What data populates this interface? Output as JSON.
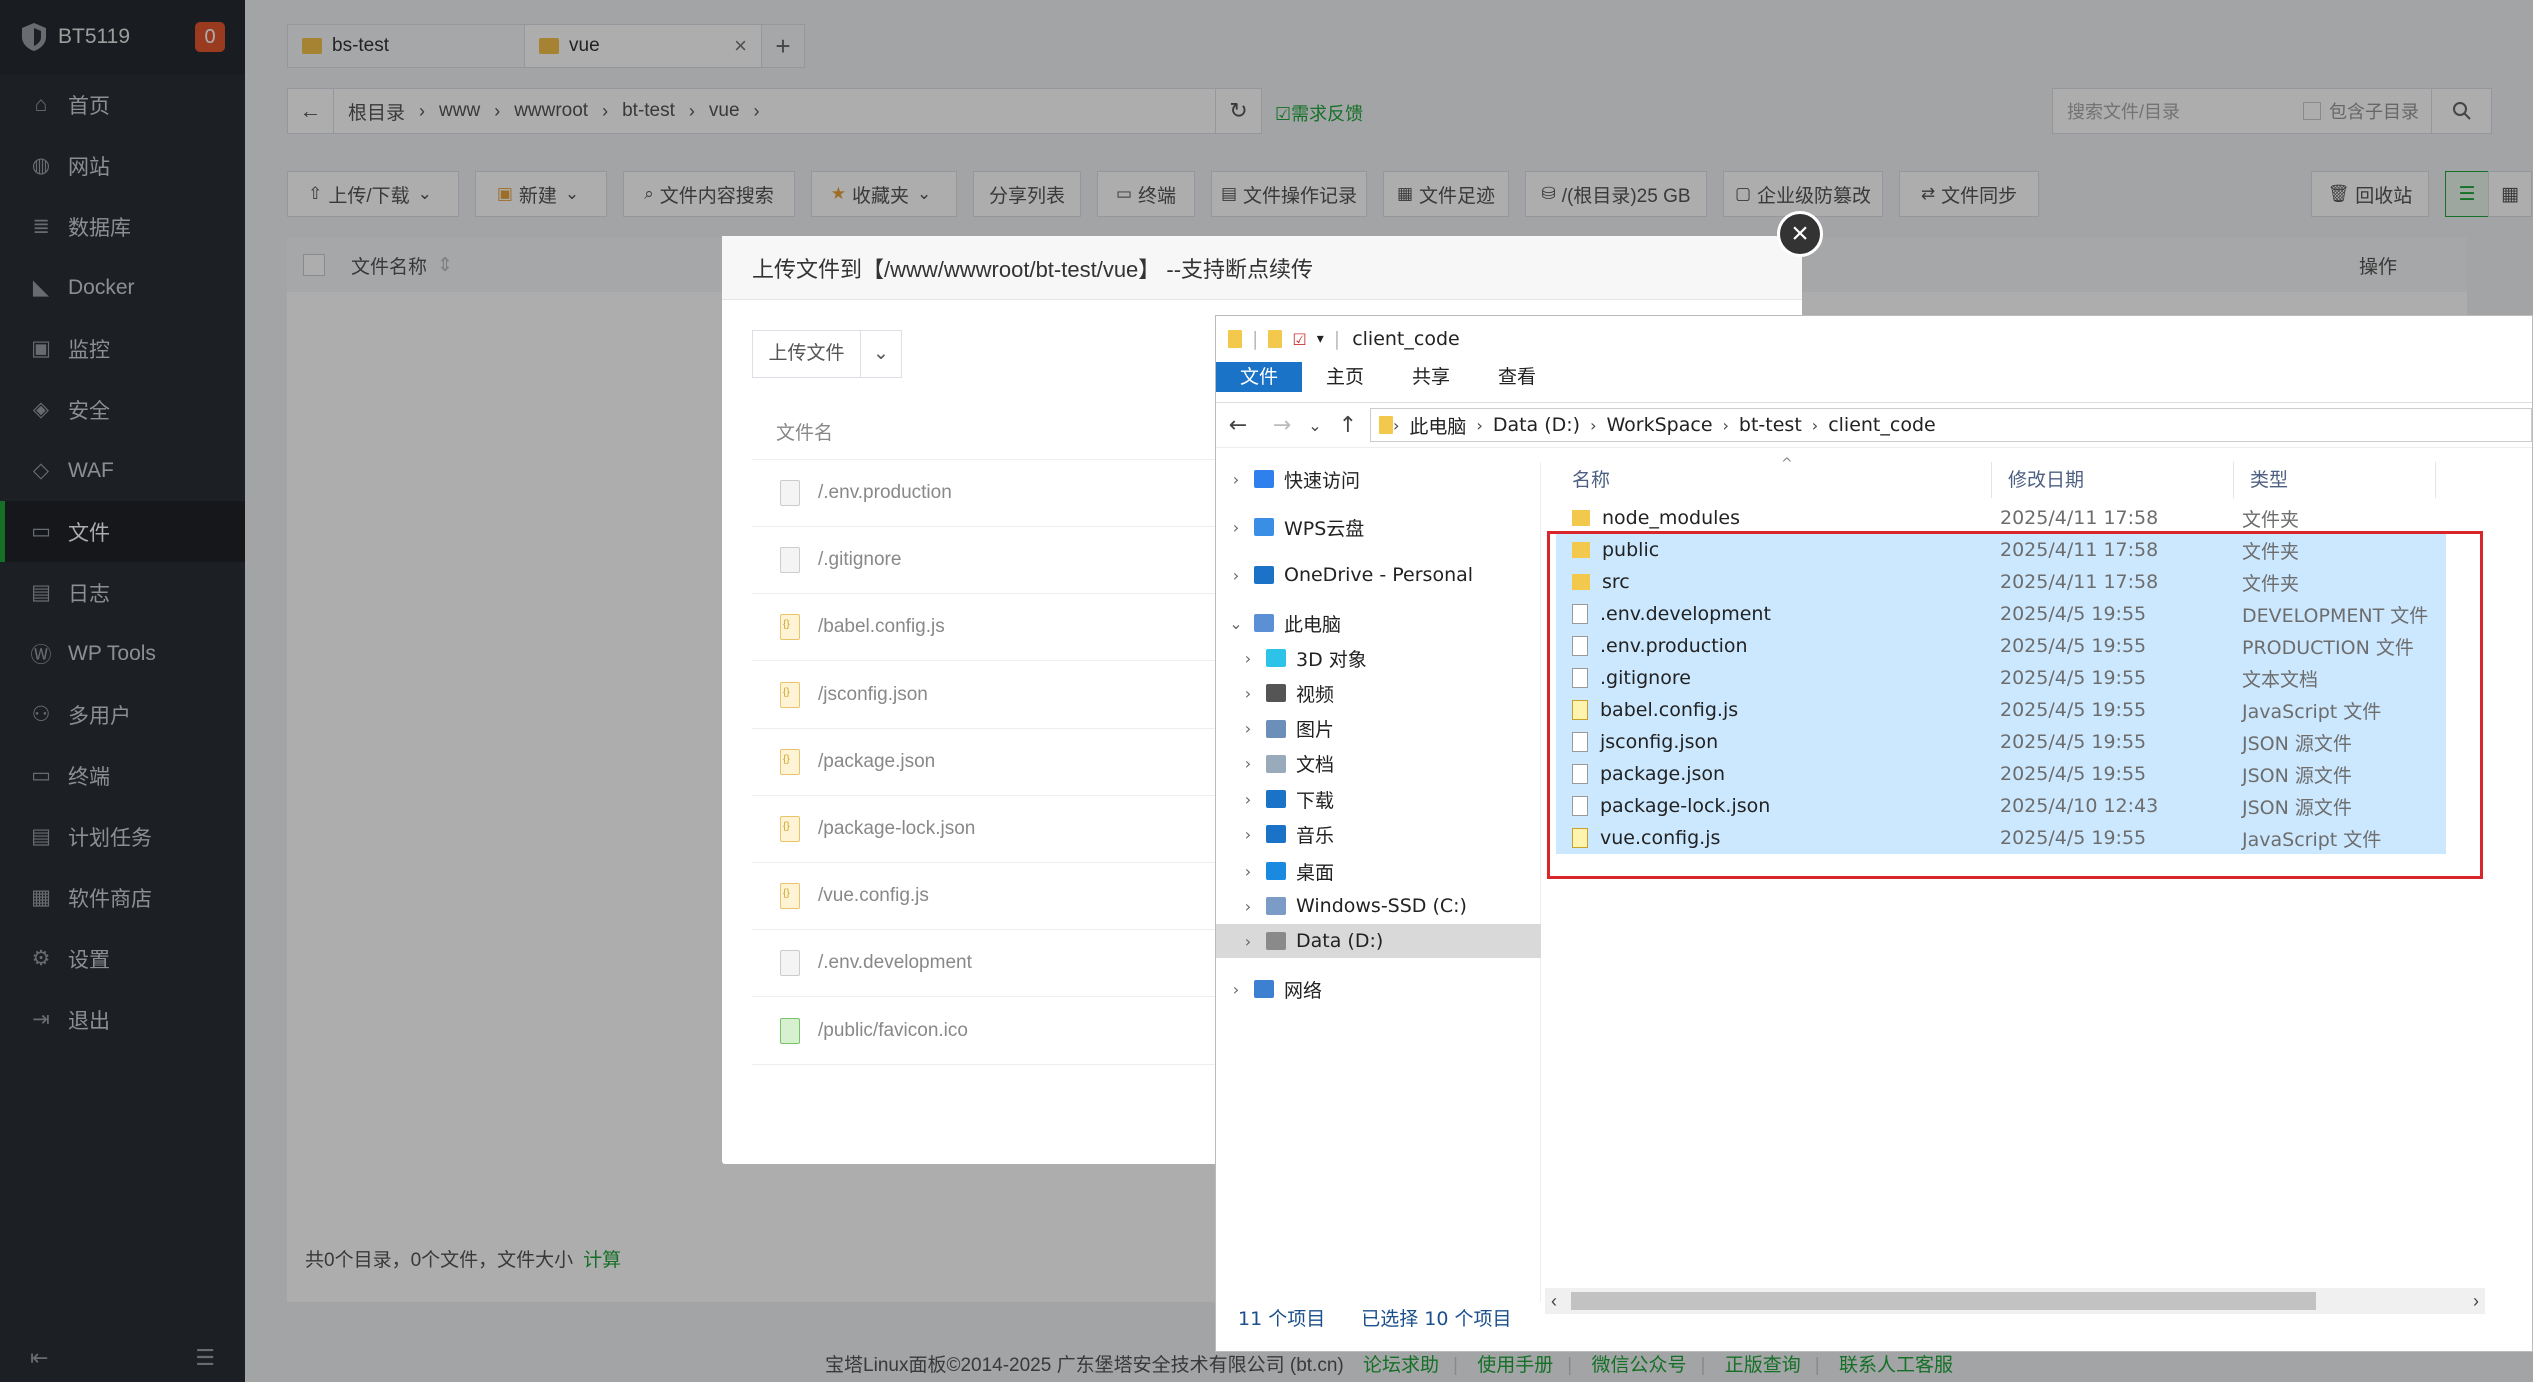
{
  "sidebar": {
    "brand": "BT5119",
    "badge": "0",
    "items": [
      {
        "label": "首页",
        "icon": "home-icon"
      },
      {
        "label": "网站",
        "icon": "globe-icon"
      },
      {
        "label": "数据库",
        "icon": "database-icon"
      },
      {
        "label": "Docker",
        "icon": "docker-icon"
      },
      {
        "label": "监控",
        "icon": "monitor-icon"
      },
      {
        "label": "安全",
        "icon": "shield-icon"
      },
      {
        "label": "WAF",
        "icon": "waf-icon"
      },
      {
        "label": "文件",
        "icon": "folder-icon"
      },
      {
        "label": "日志",
        "icon": "log-icon"
      },
      {
        "label": "WP Tools",
        "icon": "wordpress-icon"
      },
      {
        "label": "多用户",
        "icon": "users-icon"
      },
      {
        "label": "终端",
        "icon": "terminal-icon"
      },
      {
        "label": "计划任务",
        "icon": "schedule-icon"
      },
      {
        "label": "软件商店",
        "icon": "store-icon"
      },
      {
        "label": "设置",
        "icon": "gear-icon"
      },
      {
        "label": "退出",
        "icon": "logout-icon"
      }
    ],
    "active": "文件"
  },
  "tabs": [
    {
      "label": "bs-test"
    },
    {
      "label": "vue",
      "close": "×"
    }
  ],
  "add_tab": "+",
  "path": {
    "back": "←",
    "crumbs": [
      "根目录",
      "www",
      "wwwroot",
      "bt-test",
      "vue"
    ],
    "refresh": "↻",
    "feedback": "需求反馈"
  },
  "search": {
    "placeholder": "搜索文件/目录",
    "include_sub": "包含子目录"
  },
  "toolbar": {
    "upload": "上传/下载",
    "new": "新建",
    "content_search": "文件内容搜索",
    "favorites": "收藏夹",
    "share": "分享列表",
    "terminal": "终端",
    "ops_log": "文件操作记录",
    "footprint": "文件足迹",
    "disk": "/(根目录)25 GB",
    "tamper": "企业级防篡改",
    "sync": "文件同步",
    "recycle": "回收站"
  },
  "table": {
    "name_col": "文件名称",
    "op_col": "操作"
  },
  "summary": {
    "text": "共0个目录，0个文件，文件大小",
    "calc": "计算"
  },
  "footer": {
    "copyright": "宝塔Linux面板©2014-2025 广东堡塔安全技术有限公司 (bt.cn)",
    "links": [
      "论坛求助",
      "使用手册",
      "微信公众号",
      "正版查询",
      "联系人工客服"
    ]
  },
  "upload_dialog": {
    "title": "上传文件到【/www/wwwroot/bt-test/vue】 --支持断点续传",
    "upload_btn": "上传文件",
    "col_name": "文件名",
    "files": [
      {
        "name": "/.env.production",
        "kind": "txt"
      },
      {
        "name": "/.gitignore",
        "kind": "txt"
      },
      {
        "name": "/babel.config.js",
        "kind": "js"
      },
      {
        "name": "/jsconfig.json",
        "kind": "js"
      },
      {
        "name": "/package.json",
        "kind": "js"
      },
      {
        "name": "/package-lock.json",
        "kind": "js"
      },
      {
        "name": "/vue.config.js",
        "kind": "js"
      },
      {
        "name": "/.env.development",
        "kind": "txt"
      },
      {
        "name": "/public/favicon.ico",
        "kind": "ico"
      }
    ]
  },
  "explorer": {
    "title": "client_code",
    "ribbon": [
      "文件",
      "主页",
      "共享",
      "查看"
    ],
    "address": [
      "此电脑",
      "Data (D:)",
      "WorkSpace",
      "bt-test",
      "client_code"
    ],
    "tree": [
      {
        "label": "快速访问",
        "level": 0,
        "color": "#2f80ed",
        "caret": "›"
      },
      {
        "label": "WPS云盘",
        "level": 0,
        "color": "#3a8ee6",
        "caret": "›"
      },
      {
        "label": "OneDrive - Personal",
        "level": 0,
        "color": "#1a73c7",
        "caret": "›"
      },
      {
        "label": "此电脑",
        "level": 0,
        "color": "#5b8fd6",
        "caret": "⌄"
      },
      {
        "label": "3D 对象",
        "level": 1,
        "color": "#2dc3e8",
        "caret": "›"
      },
      {
        "label": "视频",
        "level": 1,
        "color": "#555",
        "caret": "›"
      },
      {
        "label": "图片",
        "level": 1,
        "color": "#6b8fb8",
        "caret": "›"
      },
      {
        "label": "文档",
        "level": 1,
        "color": "#9ab",
        "caret": "›"
      },
      {
        "label": "下载",
        "level": 1,
        "color": "#1a73c7",
        "caret": "›"
      },
      {
        "label": "音乐",
        "level": 1,
        "color": "#1a73c7",
        "caret": "›"
      },
      {
        "label": "桌面",
        "level": 1,
        "color": "#1a8ae0",
        "caret": "›"
      },
      {
        "label": "Windows-SSD (C:)",
        "level": 1,
        "color": "#7a9cc6",
        "caret": "›"
      },
      {
        "label": "Data (D:)",
        "level": 1,
        "color": "#8a8a8a",
        "caret": "›",
        "selected": true
      },
      {
        "label": "网络",
        "level": 0,
        "color": "#3d7fd1",
        "caret": "›"
      }
    ],
    "columns": [
      "名称",
      "修改日期",
      "类型"
    ],
    "files": [
      {
        "name": "node_modules",
        "date": "2025/4/11 17:58",
        "type": "文件夹",
        "icon": "folder",
        "selected": false
      },
      {
        "name": "public",
        "date": "2025/4/11 17:58",
        "type": "文件夹",
        "icon": "folder",
        "selected": true
      },
      {
        "name": "src",
        "date": "2025/4/11 17:58",
        "type": "文件夹",
        "icon": "folder",
        "selected": true
      },
      {
        "name": ".env.development",
        "date": "2025/4/5 19:55",
        "type": "DEVELOPMENT 文件",
        "icon": "file",
        "selected": true
      },
      {
        "name": ".env.production",
        "date": "2025/4/5 19:55",
        "type": "PRODUCTION 文件",
        "icon": "file",
        "selected": true
      },
      {
        "name": ".gitignore",
        "date": "2025/4/5 19:55",
        "type": "文本文档",
        "icon": "file",
        "selected": true
      },
      {
        "name": "babel.config.js",
        "date": "2025/4/5 19:55",
        "type": "JavaScript 文件",
        "icon": "js",
        "selected": true
      },
      {
        "name": "jsconfig.json",
        "date": "2025/4/5 19:55",
        "type": "JSON 源文件",
        "icon": "json",
        "selected": true
      },
      {
        "name": "package.json",
        "date": "2025/4/5 19:55",
        "type": "JSON 源文件",
        "icon": "json",
        "selected": true
      },
      {
        "name": "package-lock.json",
        "date": "2025/4/10 12:43",
        "type": "JSON 源文件",
        "icon": "json",
        "selected": true
      },
      {
        "name": "vue.config.js",
        "date": "2025/4/5 19:55",
        "type": "JavaScript 文件",
        "icon": "js",
        "selected": true
      }
    ],
    "status_count": "11 个项目",
    "status_selected": "已选择 10 个项目"
  }
}
